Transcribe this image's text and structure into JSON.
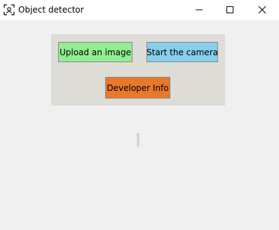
{
  "window": {
    "title": "Object detector",
    "icon": "object-detector-icon"
  },
  "controls": {
    "minimize_icon": "minimize-icon",
    "maximize_icon": "maximize-icon",
    "close_icon": "close-icon"
  },
  "buttons": {
    "upload": {
      "label": "Upload an image",
      "color": "#90ee90"
    },
    "camera": {
      "label": "Start the camera",
      "color": "#87ceeb"
    },
    "developer": {
      "label": "Developer Info",
      "color": "#e8782a"
    }
  },
  "colors": {
    "panel": "#dddcd7",
    "background": "#f0f0f0"
  }
}
